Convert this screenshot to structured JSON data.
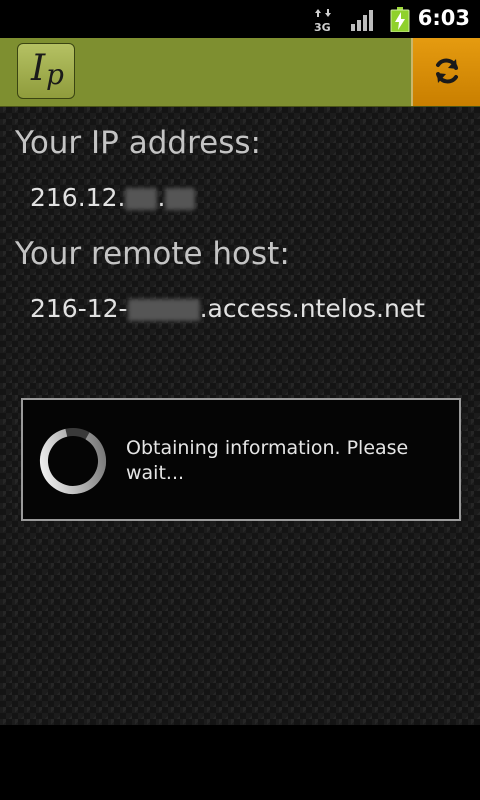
{
  "status_bar": {
    "time": "6:03",
    "network_label": "3G",
    "icons": [
      "data-3g-icon",
      "signal-icon",
      "battery-charging-icon"
    ]
  },
  "action_bar": {
    "logo_i": "I",
    "logo_p": "p",
    "refresh_icon": "refresh-icon",
    "accent_color": "#7e8f30",
    "refresh_color": "#e59b10"
  },
  "ip": {
    "label": "Your IP address:",
    "value_prefix": "216.12.",
    "value_sep": "."
  },
  "host": {
    "label": "Your remote host:",
    "value_prefix": "216-12-",
    "value_suffix": ".access.ntelos.net"
  },
  "dialog": {
    "message": "Obtaining information. Please wait...",
    "spinner_icon": "loading-spinner-icon"
  }
}
